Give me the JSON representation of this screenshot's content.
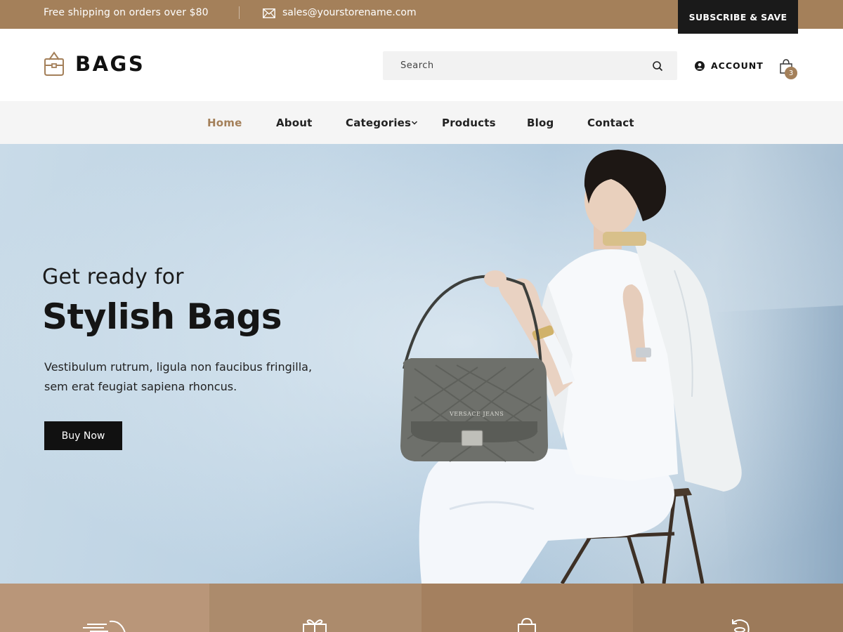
{
  "topbar": {
    "shipping": "Free shipping on orders over $80",
    "email": "sales@yourstorename.com",
    "subscribe": "SUBSCRIBE & SAVE",
    "icon": "mail-icon"
  },
  "header": {
    "logo": "BAGS",
    "logo_icon": "bag-icon",
    "search_placeholder": "Search",
    "account": "ACCOUNT",
    "cart_count": "3"
  },
  "nav": {
    "items": [
      {
        "label": "Home",
        "active": true
      },
      {
        "label": "About"
      },
      {
        "label": "Categories",
        "dropdown": true
      },
      {
        "label": "Products"
      },
      {
        "label": "Blog"
      },
      {
        "label": "Contact"
      }
    ]
  },
  "hero": {
    "pre": "Get ready for",
    "headline": "Stylish Bags",
    "description": "Vestibulum rutrum, ligula non faucibus fringilla, sem erat feugiat sapiena rhoncus.",
    "cta": "Buy Now",
    "bag_logo": "VERSACE JEANS"
  },
  "features": [
    {
      "icon": "delivery-icon",
      "color": "#b99679"
    },
    {
      "icon": "gift-icon",
      "color": "#ac8b6c"
    },
    {
      "icon": "bag-icon",
      "color": "#a4805f"
    },
    {
      "icon": "return-icon",
      "color": "#9c7a5a"
    }
  ],
  "colors": {
    "accent": "#a4805a",
    "dark": "#111111",
    "nav_bg": "#f5f5f5"
  }
}
